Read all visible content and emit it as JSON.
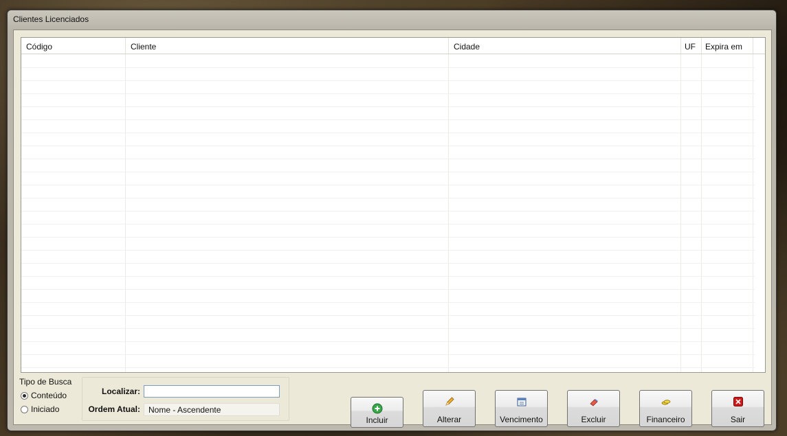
{
  "window": {
    "title": "Clientes Licenciados"
  },
  "grid": {
    "columns": [
      "Código",
      "Cliente",
      "Cidade",
      "UF",
      "Expira em"
    ],
    "rows": []
  },
  "search_type": {
    "label": "Tipo de Busca",
    "options": [
      {
        "label": "Conteúdo",
        "selected": true
      },
      {
        "label": "Iniciado",
        "selected": false
      }
    ]
  },
  "search": {
    "localizar_label": "Localizar:",
    "localizar_value": "",
    "ordem_label": "Ordem Atual:",
    "ordem_value": "Nome - Ascendente"
  },
  "buttons": {
    "incluir": {
      "label": "Incluir",
      "icon": "add-icon"
    },
    "alterar": {
      "label": "Alterar",
      "icon": "pencil-icon"
    },
    "vencimento": {
      "label": "Vencimento",
      "icon": "calendar-icon"
    },
    "excluir": {
      "label": "Excluir",
      "icon": "eraser-icon"
    },
    "financeiro": {
      "label": "Financeiro",
      "icon": "coins-icon"
    },
    "sair": {
      "label": "Sair",
      "icon": "close-icon"
    }
  },
  "colors": {
    "accent_close": "#cc1a1a",
    "add_green": "#2a9a3a"
  }
}
